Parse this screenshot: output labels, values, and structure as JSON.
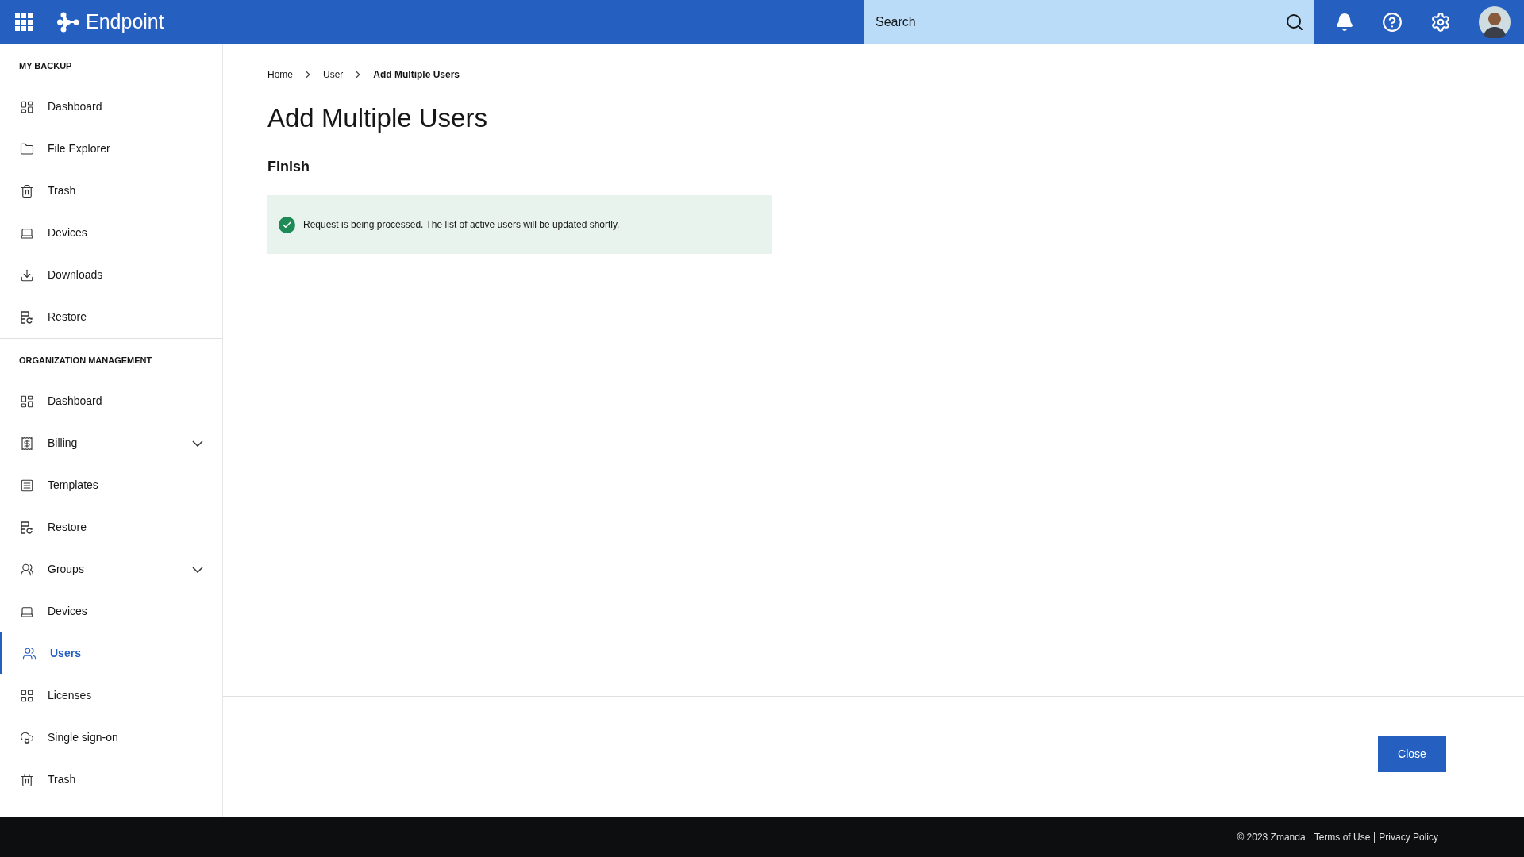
{
  "topbar": {
    "brand": "Endpoint",
    "search": {
      "placeholder": "Search"
    }
  },
  "sidebar": {
    "sections": [
      {
        "title": "MY BACKUP",
        "items": [
          {
            "label": "Dashboard",
            "kind": "link",
            "selected": false
          },
          {
            "label": "File Explorer",
            "kind": "link",
            "selected": false
          },
          {
            "label": "Trash",
            "kind": "link",
            "selected": false
          },
          {
            "label": "Devices",
            "kind": "link",
            "selected": false
          },
          {
            "label": "Downloads",
            "kind": "link",
            "selected": false
          },
          {
            "label": "Restore",
            "kind": "link",
            "selected": false
          }
        ]
      },
      {
        "title": "ORGANIZATION MANAGEMENT",
        "items": [
          {
            "label": "Dashboard",
            "kind": "link",
            "selected": false
          },
          {
            "label": "Billing",
            "kind": "group",
            "expanded": false,
            "selected": false
          },
          {
            "label": "Templates",
            "kind": "link",
            "selected": false
          },
          {
            "label": "Restore",
            "kind": "link",
            "selected": false
          },
          {
            "label": "Groups",
            "kind": "group",
            "expanded": false,
            "selected": false
          },
          {
            "label": "Devices",
            "kind": "link",
            "selected": false
          },
          {
            "label": "Users",
            "kind": "link",
            "selected": true
          },
          {
            "label": "Licenses",
            "kind": "link",
            "selected": false
          },
          {
            "label": "Single sign-on",
            "kind": "link",
            "selected": false
          },
          {
            "label": "Trash",
            "kind": "link",
            "selected": false
          }
        ]
      }
    ]
  },
  "breadcrumb": [
    {
      "label": "Home",
      "current": false
    },
    {
      "label": "User",
      "current": false
    },
    {
      "label": "Add Multiple Users",
      "current": true
    }
  ],
  "page": {
    "title": "Add Multiple Users",
    "step": "Finish",
    "alert": {
      "kind": "success",
      "message": "Request is being processed. The list of active users will be updated shortly."
    }
  },
  "actions": {
    "close": "Close"
  },
  "footer": [
    "© 2023 Zmanda",
    "Terms of Use",
    "Privacy Policy"
  ]
}
